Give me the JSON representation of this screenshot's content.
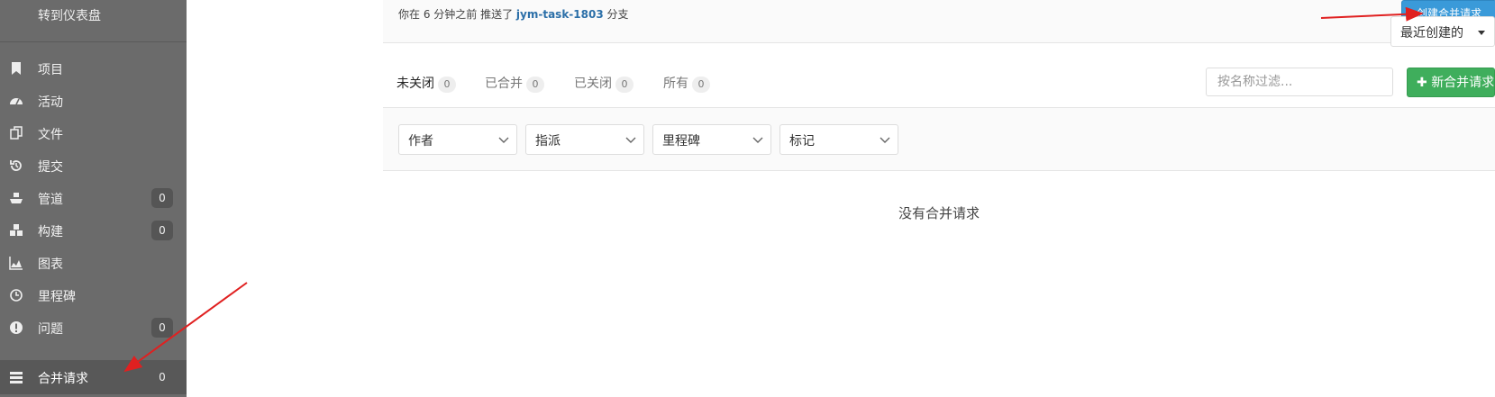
{
  "sidebar": {
    "dashboard_link": "转到仪表盘",
    "items": [
      {
        "label": "项目",
        "icon": "bookmark-icon",
        "count": ""
      },
      {
        "label": "活动",
        "icon": "dashboard-icon",
        "count": ""
      },
      {
        "label": "文件",
        "icon": "files-icon",
        "count": ""
      },
      {
        "label": "提交",
        "icon": "history-icon",
        "count": ""
      },
      {
        "label": "管道",
        "icon": "ship-icon",
        "count": "0"
      },
      {
        "label": "构建",
        "icon": "cubes-icon",
        "count": "0"
      },
      {
        "label": "图表",
        "icon": "area-chart-icon",
        "count": ""
      },
      {
        "label": "里程碑",
        "icon": "clock-icon",
        "count": ""
      },
      {
        "label": "问题",
        "icon": "exclamation-circle-icon",
        "count": "0"
      },
      {
        "label": "合并请求",
        "icon": "tasks-icon",
        "count": "0"
      }
    ]
  },
  "push_notice": {
    "prefix": "你在 6 分钟之前 推送了",
    "branch": "jym-task-1803",
    "suffix": "分支",
    "button": "创建合并请求"
  },
  "tabs": [
    {
      "label": "未关闭",
      "count": "0"
    },
    {
      "label": "已合并",
      "count": "0"
    },
    {
      "label": "已关闭",
      "count": "0"
    },
    {
      "label": "所有",
      "count": "0"
    }
  ],
  "filter": {
    "placeholder": "按名称过滤...",
    "new_button": "新合并请求"
  },
  "dropdowns": [
    "作者",
    "指派",
    "里程碑",
    "标记"
  ],
  "sort_label": "最近创建的",
  "empty_message": "没有合并请求",
  "colors": {
    "sidebar": "#6b6b6b",
    "accent_blue": "#3a9ad9",
    "green": "#3fae5c",
    "annotation_red": "#e02020"
  }
}
